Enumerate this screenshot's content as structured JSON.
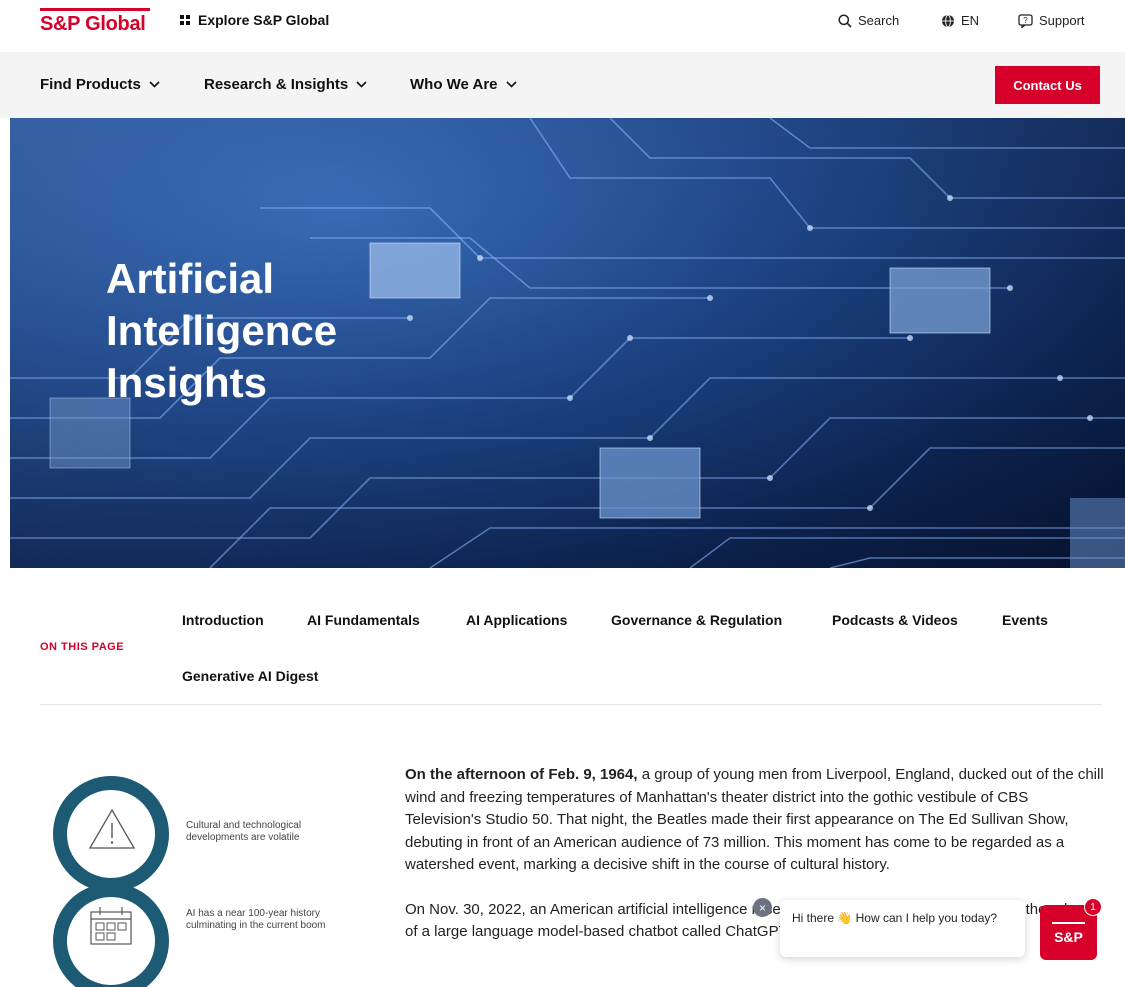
{
  "header": {
    "logo_text": "S&P Global",
    "explore_label": "Explore S&P Global",
    "search_label": "Search",
    "language_label": "EN",
    "support_label": "Support"
  },
  "nav": {
    "items": [
      {
        "label": "Find Products"
      },
      {
        "label": "Research & Insights"
      },
      {
        "label": "Who We Are"
      }
    ],
    "contact_label": "Contact Us"
  },
  "hero": {
    "title_lines": [
      "Artificial",
      "Intelligence",
      "Insights"
    ]
  },
  "on_this_page": {
    "label": "ON THIS PAGE",
    "links": [
      "Introduction",
      "AI Fundamentals",
      "AI Applications",
      "Governance & Regulation",
      "Podcasts & Videos",
      "Events",
      "Generative AI Digest"
    ]
  },
  "infographic": {
    "items": [
      {
        "text": "Cultural and technological developments are volatile",
        "icon": "warning-icon"
      },
      {
        "text": "AI has a near 100-year history culminating in the current boom",
        "icon": "calendar-icon"
      }
    ]
  },
  "article": {
    "p1_lead": "On the afternoon of Feb. 9, 1964,",
    "p1_body": " a group of young men from Liverpool, England, ducked out of the chill wind and freezing temperatures of Manhattan's theater district into the gothic vestibule of CBS Television's Studio 50. That night, the Beatles made their first appearance on The Ed Sullivan Show, debuting in front of an American audience of 73 million. This moment has come to be regarded as a watershed event, marking a decisive shift in the course of cultural history.",
    "p2": "On Nov. 30, 2022, an American artificial intelligence research laboratory, OpenAI, announced the release of a large language model-based chatbot called ChatGPT. The"
  },
  "chat": {
    "greeting": "Hi there 👋 How can I help you today?",
    "close_label": "×",
    "launcher_label": "S&P",
    "badge_count": "1"
  },
  "colors": {
    "brand_red": "#d6002a",
    "ring_teal": "#1c5b73"
  }
}
